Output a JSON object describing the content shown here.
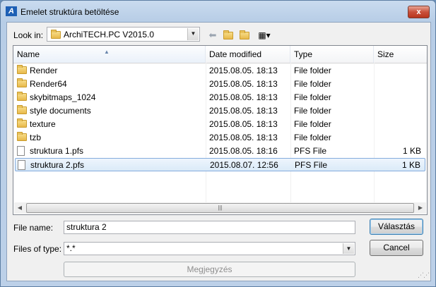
{
  "window": {
    "title": "Emelet struktúra betöltése",
    "close_glyph": "x"
  },
  "toolbar": {
    "look_in_label": "Look in:",
    "look_in_value": "ArchiTECH.PC V2015.0",
    "back_icon": "back-arrow-icon",
    "up_icon": "up-folder-icon",
    "new_folder_icon": "new-folder-icon",
    "views_icon": "views-menu-icon"
  },
  "columns": {
    "name": "Name",
    "date": "Date modified",
    "type": "Type",
    "size": "Size"
  },
  "files": [
    {
      "kind": "folder",
      "name": "Render",
      "date": "2015.08.05. 18:13",
      "type": "File folder",
      "size": ""
    },
    {
      "kind": "folder",
      "name": "Render64",
      "date": "2015.08.05. 18:13",
      "type": "File folder",
      "size": ""
    },
    {
      "kind": "folder",
      "name": "skybitmaps_1024",
      "date": "2015.08.05. 18:13",
      "type": "File folder",
      "size": ""
    },
    {
      "kind": "folder",
      "name": "style documents",
      "date": "2015.08.05. 18:13",
      "type": "File folder",
      "size": ""
    },
    {
      "kind": "folder",
      "name": "texture",
      "date": "2015.08.05. 18:13",
      "type": "File folder",
      "size": ""
    },
    {
      "kind": "folder",
      "name": "tzb",
      "date": "2015.08.05. 18:13",
      "type": "File folder",
      "size": ""
    },
    {
      "kind": "file",
      "name": "struktura 1.pfs",
      "date": "2015.08.05. 18:16",
      "type": "PFS File",
      "size": "1 KB"
    },
    {
      "kind": "file",
      "name": "struktura 2.pfs",
      "date": "2015.08.07. 12:56",
      "type": "PFS File",
      "size": "1 KB",
      "selected": true
    }
  ],
  "form": {
    "file_name_label": "File name:",
    "file_name_value": "struktura 2",
    "file_type_label": "Files of type:",
    "file_type_value": "*.*"
  },
  "buttons": {
    "open": "Választás",
    "cancel": "Cancel",
    "note": "Megjegyzés"
  },
  "colors": {
    "selection_border": "#84acdd",
    "titlebar": "#c9dbef",
    "close_button": "#c9503b"
  }
}
